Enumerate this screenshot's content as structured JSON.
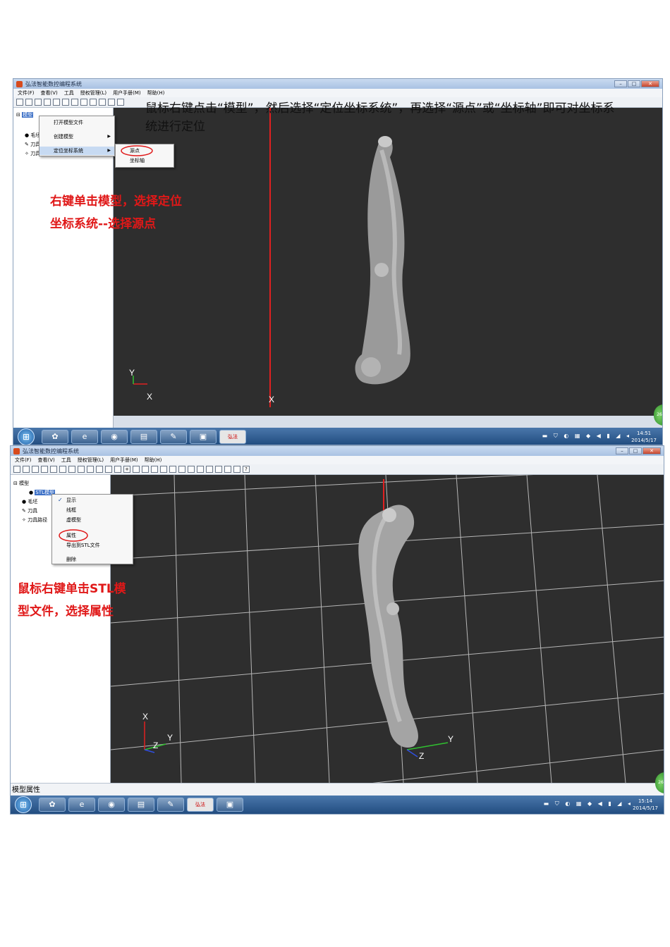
{
  "caption_text": "鼠标右键点击“模型”，然后选择“定位坐标系统”，再选择“源点”或“坐标轴”即可对坐标系统进行定位",
  "window_title": "弘法智能数控编程系统",
  "menu": [
    "文件(F)",
    "查看(V)",
    "工具",
    "授权管理(L)",
    "用户手册(M)",
    "帮助(H)"
  ],
  "shot1": {
    "tree": [
      "模型",
      "毛坯",
      "刀具",
      "刀具路径"
    ],
    "context_menu": [
      "打开模型文件",
      "创建模型",
      "定位坐标系统"
    ],
    "submenu": [
      "源点",
      "坐标轴"
    ],
    "note_line1": "右键单击模型，选择定位",
    "note_line2": "坐标系统--选择源点",
    "axis_y": "Y",
    "axis_x": "X",
    "axis_x2": "X",
    "clock_time": "14:51",
    "clock_date": "2014/5/17"
  },
  "shot2": {
    "tree": [
      "模型",
      "STL模型",
      "毛坯",
      "刀具",
      "刀具路径"
    ],
    "context_menu": [
      "显示",
      "线框",
      "虚模型",
      "属性",
      "导出到STL文件",
      "删除"
    ],
    "check": "✓",
    "note_line1": "鼠标右键单击STL模",
    "note_line2": "型文件，选择属性",
    "axis_x": "X",
    "axis_y": "Y",
    "axis_z": "Z",
    "axis_y2": "Y",
    "axis_z2": "Z",
    "status": "模型属性",
    "clock_time": "15:14",
    "clock_date": "2014/5/17"
  },
  "taskbar_badge": "弘法",
  "colors": {
    "viewport": "#2e2e2e",
    "note": "#e01818",
    "axis_red": "#e02020"
  }
}
